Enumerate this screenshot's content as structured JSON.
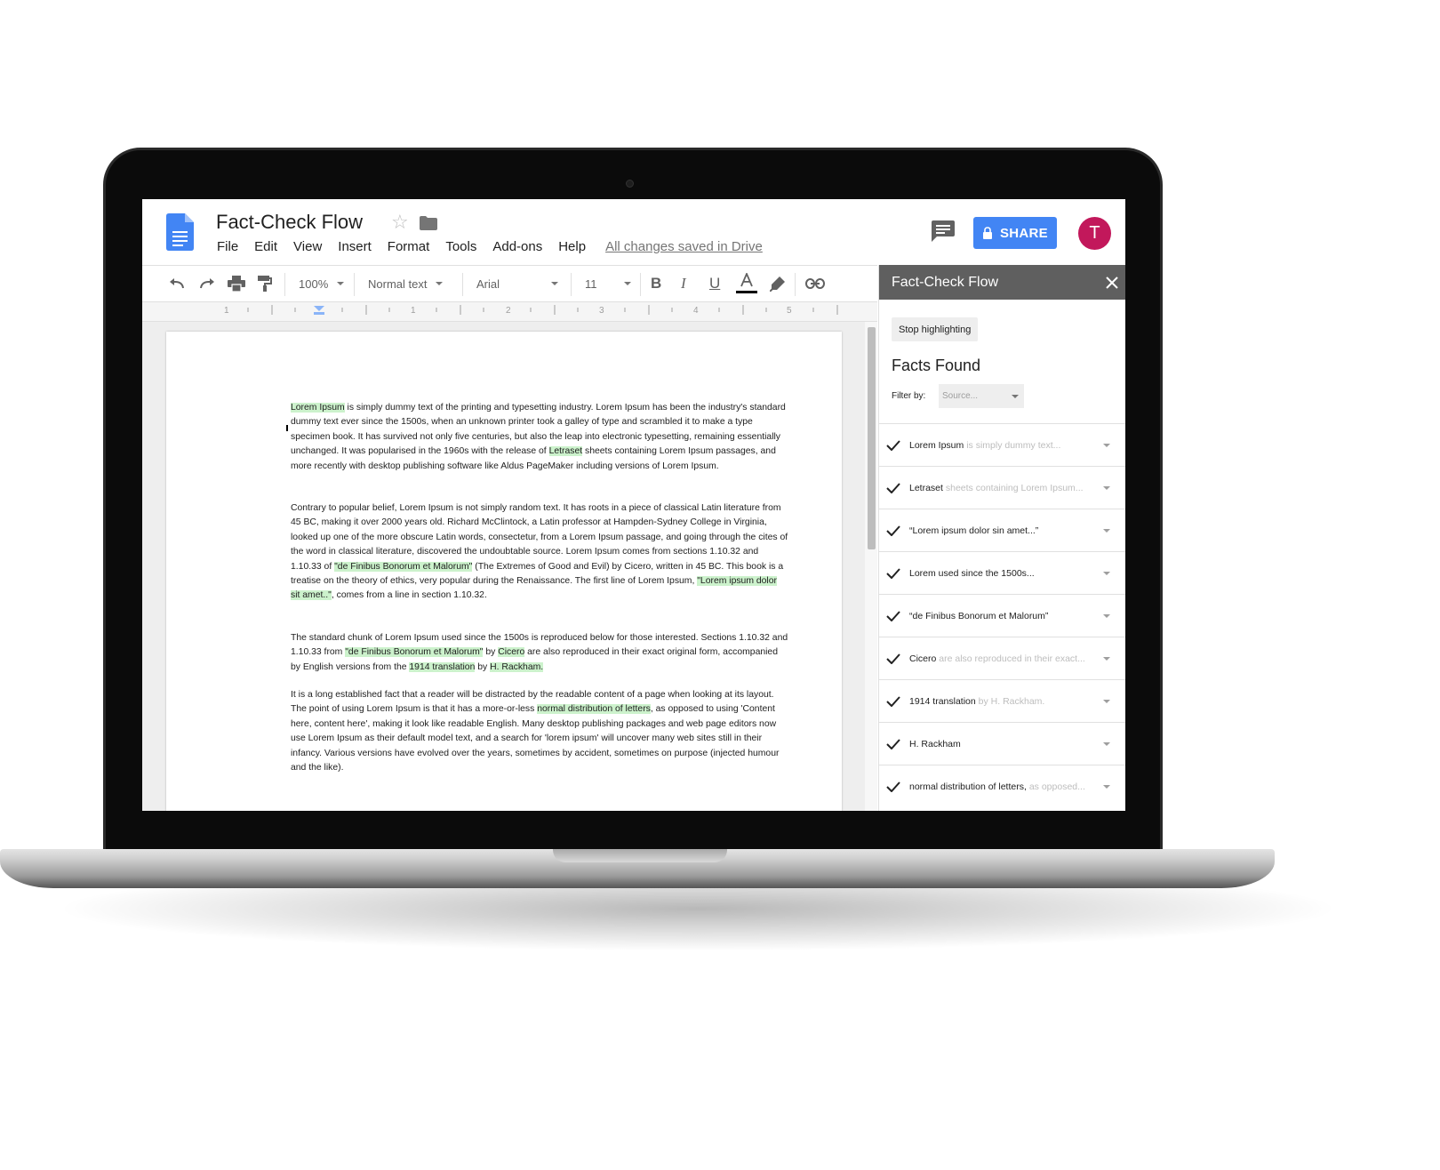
{
  "document": {
    "title": "Fact-Check Flow",
    "menu": [
      "File",
      "Edit",
      "View",
      "Insert",
      "Format",
      "Tools",
      "Add-ons",
      "Help"
    ],
    "saved_status": "All changes saved in Drive",
    "share_label": "SHARE",
    "avatar_initial": "T"
  },
  "toolbar": {
    "zoom": "100%",
    "style": "Normal text",
    "font": "Arial",
    "font_size": "11"
  },
  "ruler": {
    "numbers": [
      "1",
      "1",
      "2",
      "3",
      "4",
      "5"
    ]
  },
  "body": {
    "p1": [
      {
        "t": "Lorem Ipsum",
        "h": true
      },
      {
        "t": " is simply dummy text of the printing and typesetting industry. Lorem Ipsum has been the industry's standard dummy text ever since the 1500s, when an unknown printer took a galley of type and scrambled it to make a type specimen book. It has survived not only five centuries, but also the leap into electronic typesetting, remaining essentially unchanged. It was popularised in the 1960s with the release of ",
        "h": false
      },
      {
        "t": "Letraset",
        "h": true
      },
      {
        "t": " sheets containing Lorem Ipsum passages, and more recently with desktop publishing software like Aldus PageMaker including versions of Lorem Ipsum.",
        "h": false
      }
    ],
    "p2": [
      {
        "t": "Contrary to popular belief, Lorem Ipsum is not simply random text. It has roots in a piece of classical Latin literature from 45 BC, making it over 2000 years old. Richard McClintock, a Latin professor at Hampden-Sydney College in Virginia, looked up one of the more obscure Latin words, consectetur, from a Lorem Ipsum passage, and going through the cites of the word in classical literature, discovered the undoubtable source. Lorem Ipsum comes from sections 1.10.32 and 1.10.33 of ",
        "h": false
      },
      {
        "t": "\"de Finibus Bonorum et Malorum\"",
        "h": true
      },
      {
        "t": " (The Extremes of Good and Evil) by Cicero, written in 45 BC. This book is a treatise on the theory of ethics, very popular during the Renaissance. The first line of Lorem Ipsum, ",
        "h": false
      },
      {
        "t": "\"Lorem ipsum dolor sit amet..\"",
        "h": true
      },
      {
        "t": ", comes from a line in section 1.10.32.",
        "h": false
      }
    ],
    "p3": [
      {
        "t": "The standard chunk of Lorem Ipsum used since the 1500s is reproduced below for those interested. Sections 1.10.32 and 1.10.33 from ",
        "h": false
      },
      {
        "t": "\"de Finibus Bonorum et Malorum\"",
        "h": true
      },
      {
        "t": " by ",
        "h": false
      },
      {
        "t": "Cicero",
        "h": true
      },
      {
        "t": " are also reproduced in their exact original form, accompanied by English versions from the ",
        "h": false
      },
      {
        "t": "1914 translation",
        "h": true
      },
      {
        "t": " by ",
        "h": false
      },
      {
        "t": "H. Rackham.",
        "h": true
      }
    ],
    "p4": [
      {
        "t": "It is a long established fact that a reader will be distracted by the readable content of a page when looking at its layout. The point of using Lorem Ipsum is that it has a more-or-less ",
        "h": false
      },
      {
        "t": "normal distribution of letters",
        "h": true
      },
      {
        "t": ", as opposed to using 'Content here, content here', making it look like readable English. Many desktop publishing packages and web page editors now use Lorem Ipsum as their default model text, and a search for 'lorem ipsum' will uncover many web sites still in their infancy. Various versions have evolved over the years, sometimes by accident, sometimes on purpose (injected humour and the like).",
        "h": false
      }
    ]
  },
  "panel": {
    "title": "Fact-Check Flow",
    "stop_button": "Stop highlighting",
    "facts_title": "Facts Found",
    "filter_label": "Filter by:",
    "filter_placeholder": "Source...",
    "facts": [
      {
        "main": "Lorem Ipsum",
        "muted": "is simply dummy text..."
      },
      {
        "main": "Letraset",
        "muted": "sheets containing Lorem Ipsum..."
      },
      {
        "main": "“Lorem ipsum dolor sin amet...”",
        "muted": ""
      },
      {
        "main": "Lorem used since the 1500s...",
        "muted": ""
      },
      {
        "main": "“de Finibus Bonorum et Malorum”",
        "muted": ""
      },
      {
        "main": "Cicero",
        "muted": "are also reproduced in their exact..."
      },
      {
        "main": "1914 translation",
        "muted": "by H. Rackham."
      },
      {
        "main": "H. Rackham",
        "muted": ""
      },
      {
        "main": "normal distribution of letters,",
        "muted": "as opposed..."
      }
    ]
  },
  "colors": {
    "share": "#4285f4",
    "avatar": "#c2185b",
    "highlight": "#ccf2cc",
    "panel_header": "#5f5f5f"
  },
  "icons": {
    "toolbar": [
      "undo-icon",
      "redo-icon",
      "print-icon",
      "paint-format-icon",
      "bold-icon",
      "italic-icon",
      "underline-icon",
      "text-color-icon",
      "highlight-icon",
      "link-icon"
    ]
  }
}
